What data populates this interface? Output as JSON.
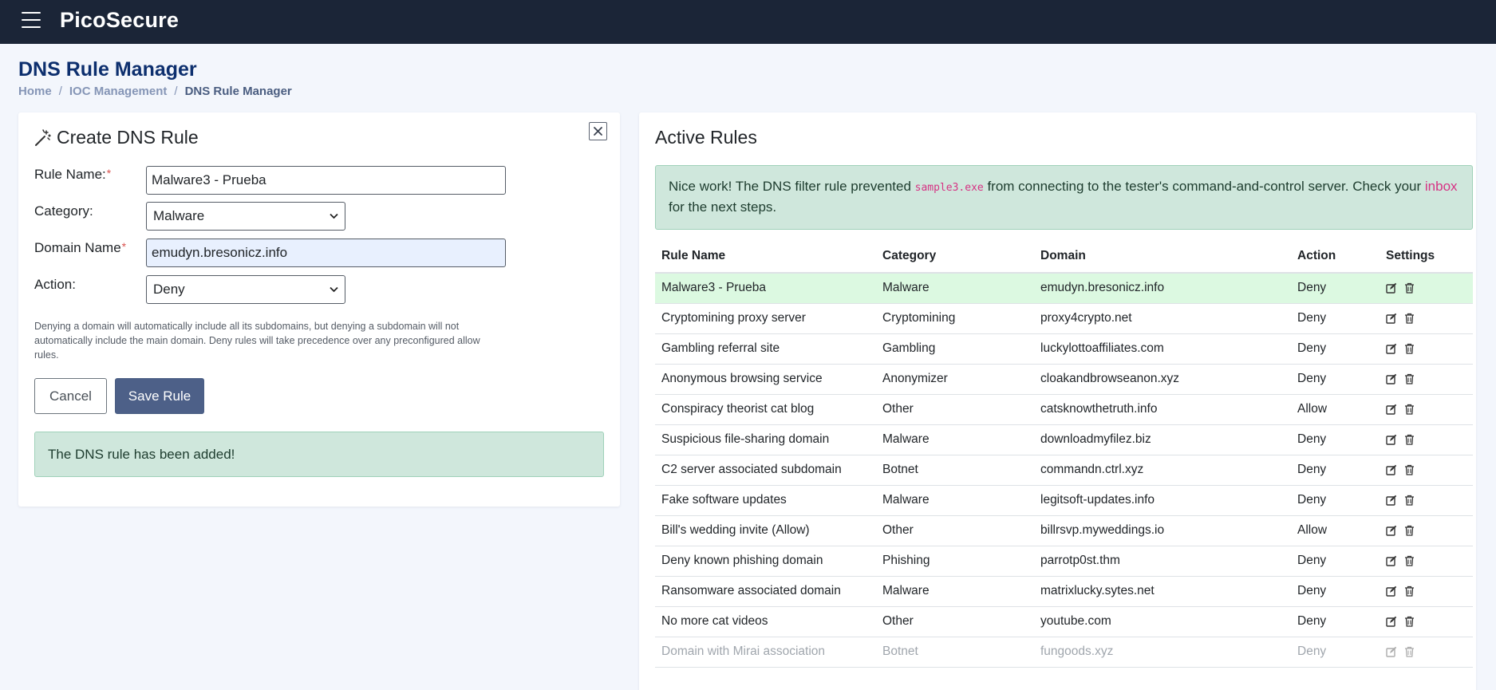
{
  "app": {
    "brand": "PicoSecure"
  },
  "page": {
    "title": "DNS Rule Manager",
    "breadcrumb": [
      {
        "label": "Home"
      },
      {
        "label": "IOC Management"
      },
      {
        "label": "DNS Rule Manager"
      }
    ],
    "breadcrumb_separator": "/"
  },
  "create_form": {
    "title": "Create DNS Rule",
    "rule_name_label": "Rule Name:",
    "rule_name_value": "Malware3 - Prueba",
    "category_label": "Category:",
    "category_value": "Malware",
    "domain_label": "Domain Name",
    "domain_value": "emudyn.bresonicz.info",
    "action_label": "Action:",
    "action_value": "Deny",
    "required_mark": "*",
    "help_text": "Denying a domain will automatically include all its subdomains, but denying a subdomain will not automatically include the main domain. Deny rules will take precedence over any preconfigured allow rules.",
    "cancel_label": "Cancel",
    "save_label": "Save Rule",
    "success_message": "The DNS rule has been added!"
  },
  "active_rules": {
    "title": "Active Rules",
    "alert": {
      "before": "Nice work! The DNS filter rule prevented ",
      "code": "sample3.exe",
      "middle": " from connecting to the tester's command-and-control server. Check your ",
      "link": "inbox",
      "after": " for the next steps."
    },
    "columns": [
      "Rule Name",
      "Category",
      "Domain",
      "Action",
      "Settings"
    ],
    "rows": [
      {
        "name": "Malware3 - Prueba",
        "category": "Malware",
        "domain": "emudyn.bresonicz.info",
        "action": "Deny"
      },
      {
        "name": "Cryptomining proxy server",
        "category": "Cryptomining",
        "domain": "proxy4crypto.net",
        "action": "Deny"
      },
      {
        "name": "Gambling referral site",
        "category": "Gambling",
        "domain": "luckylottoaffiliates.com",
        "action": "Deny"
      },
      {
        "name": "Anonymous browsing service",
        "category": "Anonymizer",
        "domain": "cloakandbrowseanon.xyz",
        "action": "Deny"
      },
      {
        "name": "Conspiracy theorist cat blog",
        "category": "Other",
        "domain": "catsknowthetruth.info",
        "action": "Allow"
      },
      {
        "name": "Suspicious file-sharing domain",
        "category": "Malware",
        "domain": "downloadmyfilez.biz",
        "action": "Deny"
      },
      {
        "name": "C2 server associated subdomain",
        "category": "Botnet",
        "domain": "commandn.ctrl.xyz",
        "action": "Deny"
      },
      {
        "name": "Fake software updates",
        "category": "Malware",
        "domain": "legitsoft-updates.info",
        "action": "Deny"
      },
      {
        "name": "Bill's wedding invite (Allow)",
        "category": "Other",
        "domain": "billrsvp.myweddings.io",
        "action": "Allow"
      },
      {
        "name": "Deny known phishing domain",
        "category": "Phishing",
        "domain": "parrotp0st.thm",
        "action": "Deny"
      },
      {
        "name": "Ransomware associated domain",
        "category": "Malware",
        "domain": "matrixlucky.sytes.net",
        "action": "Deny"
      },
      {
        "name": "No more cat videos",
        "category": "Other",
        "domain": "youtube.com",
        "action": "Deny"
      },
      {
        "name": "Domain with Mirai association",
        "category": "Botnet",
        "domain": "fungoods.xyz",
        "action": "Deny"
      }
    ]
  },
  "icons": {
    "menu": "hamburger-icon",
    "close": "close-icon",
    "wand": "magic-wand-icon",
    "edit": "edit-icon",
    "delete": "trash-icon",
    "dropdown": "chevron-down-icon"
  },
  "colors": {
    "topbar": "#1b2537",
    "title": "#0d2f6e",
    "primary_button": "#4d6088",
    "success_bg": "#cfe7dc",
    "highlight_row": "#dcf9e1",
    "code_link": "#d63384"
  }
}
